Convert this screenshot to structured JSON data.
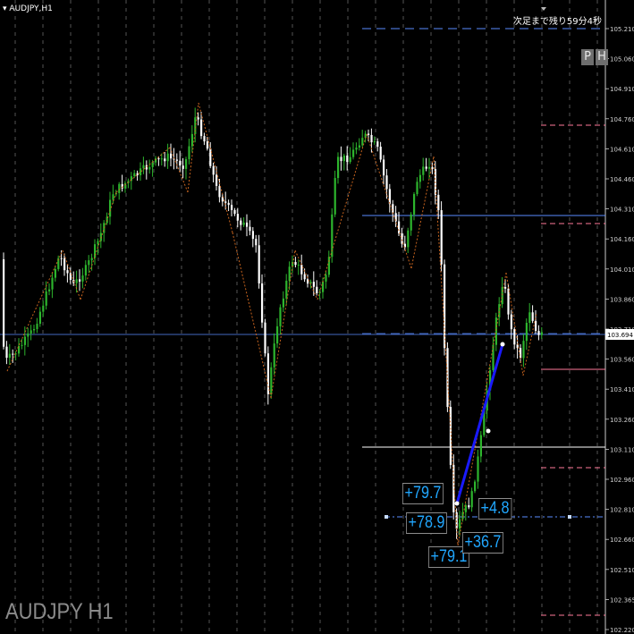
{
  "window": {
    "symbol_label": "AUDJPY,H1",
    "countdown": "次足まで残り59分4秒",
    "watermark": "AUDJPY H1",
    "buttons": {
      "p": "P",
      "h": "H"
    }
  },
  "price_axis": {
    "ticks": [
      "105.210",
      "105.060",
      "104.910",
      "104.760",
      "104.610",
      "104.460",
      "104.310",
      "104.160",
      "104.010",
      "103.860",
      "103.710",
      "103.560",
      "103.410",
      "103.260",
      "103.110",
      "102.960",
      "102.810",
      "102.660",
      "102.510",
      "102.365",
      "102.220"
    ],
    "current_price": "103.694"
  },
  "pip_labels": [
    {
      "text": "+79.7"
    },
    {
      "text": "+78.9"
    },
    {
      "text": "+79.1"
    },
    {
      "text": "+36.7"
    },
    {
      "text": "+4.8"
    }
  ],
  "colors": {
    "bull_candle": "#2db52d",
    "bear_candle": "#ffffff",
    "zigzag": "#c8641e",
    "trend_line": "#1a1aff",
    "level_blue": "#5a8cff",
    "level_pink": "#ff7a9a",
    "pip_text": "#21a7ff",
    "grid": "#ffffff"
  }
}
